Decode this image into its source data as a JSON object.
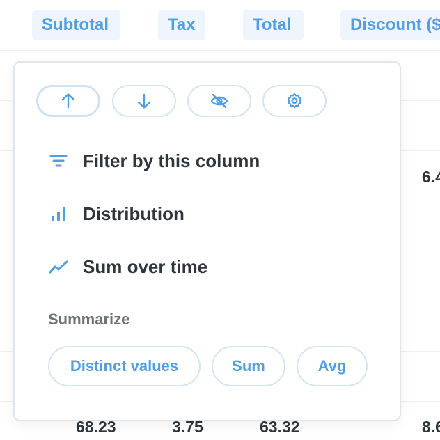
{
  "table": {
    "headers": {
      "subtotal": "Subtotal",
      "tax": "Tax",
      "total": "Total",
      "discount": "Discount ($"
    },
    "partial_cell_discount_row2": "6.4",
    "last_row": {
      "subtotal": "68.23",
      "tax": "3.75",
      "total": "63.32",
      "discount": "8.6"
    }
  },
  "popover": {
    "sort_buttons": [
      {
        "icon": "arrow-up-icon",
        "action": "sort-ascending"
      },
      {
        "icon": "arrow-down-icon",
        "action": "sort-descending"
      },
      {
        "icon": "eye-crossed-icon",
        "action": "hide-column"
      },
      {
        "icon": "gear-icon",
        "action": "column-settings"
      }
    ],
    "menu_items": {
      "filter": "Filter by this column",
      "distribution": "Distribution",
      "sum_over_time": "Sum over time"
    },
    "summarize": {
      "label": "Summarize",
      "options": {
        "distinct": "Distinct values",
        "sum": "Sum",
        "avg": "Avg"
      }
    }
  },
  "colors": {
    "accent": "#509ee3",
    "text": "#2e353b",
    "muted": "#6b7378",
    "border": "#d3e4f4",
    "header_bg": "#eef5fc"
  }
}
